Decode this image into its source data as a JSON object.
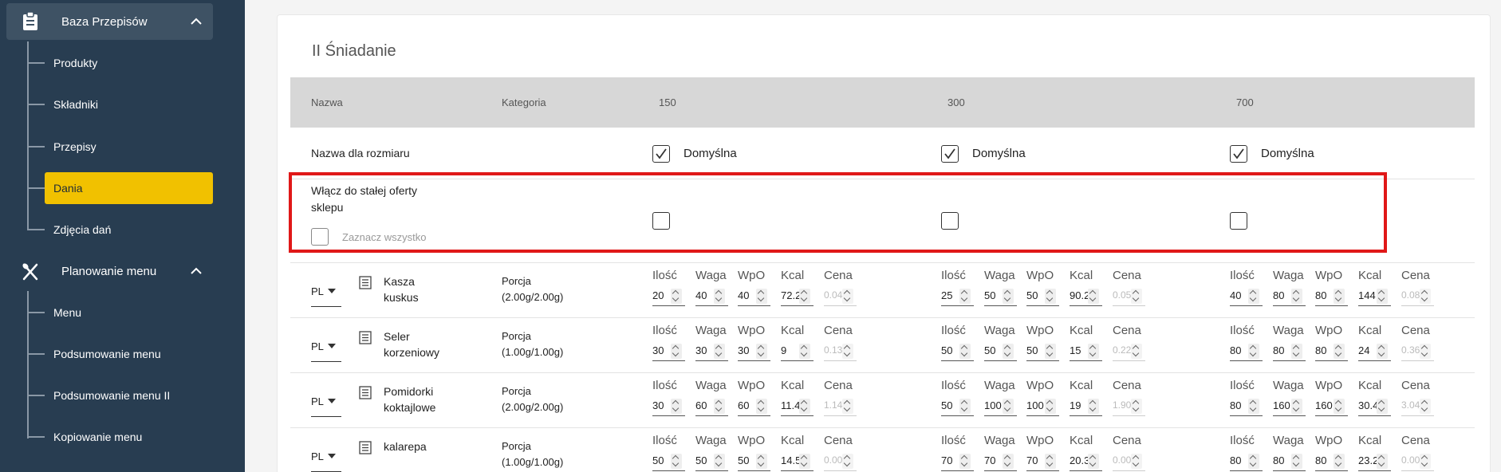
{
  "sidebar": {
    "section1": {
      "label": "Baza Przepisów",
      "icon": "clipboard-icon"
    },
    "items1": [
      {
        "label": "Produkty"
      },
      {
        "label": "Składniki"
      },
      {
        "label": "Przepisy"
      },
      {
        "label": "Dania",
        "selected": true
      },
      {
        "label": "Zdjęcia dań"
      }
    ],
    "section2": {
      "label": "Planowanie menu",
      "icon": "utensils-icon"
    },
    "items2": [
      {
        "label": "Menu"
      },
      {
        "label": "Podsumowanie menu"
      },
      {
        "label": "Podsumowanie menu II"
      },
      {
        "label": "Kopiowanie menu"
      }
    ]
  },
  "card": {
    "title": "II Śniadanie",
    "headers": {
      "name": "Nazwa",
      "category": "Kategoria",
      "size1": "150",
      "size2": "300",
      "size3": "700"
    },
    "size_name_row": {
      "label": "Nazwa dla rozmiaru",
      "default_label": "Domyślna"
    },
    "offer_row": {
      "label_line1": "Włącz do stałej oferty",
      "label_line2": "sklepu",
      "select_all": "Zaznacz wszystko"
    },
    "col_heads": [
      "Ilość",
      "Waga",
      "WpO",
      "Kcal",
      "Cena"
    ],
    "products": [
      {
        "lang": "PL",
        "name1": "Kasza",
        "name2": "kuskus",
        "cat1": "Porcja",
        "cat2": "(2.00g/2.00g)",
        "sizes": [
          [
            "20",
            "40",
            "40",
            "72.2",
            "0.04"
          ],
          [
            "25",
            "50",
            "50",
            "90.2",
            "0.05"
          ],
          [
            "40",
            "80",
            "80",
            "144",
            "0.08"
          ]
        ]
      },
      {
        "lang": "PL",
        "name1": "Seler",
        "name2": "korzeniowy",
        "cat1": "Porcja",
        "cat2": "(1.00g/1.00g)",
        "sizes": [
          [
            "30",
            "30",
            "30",
            "9",
            "0.13"
          ],
          [
            "50",
            "50",
            "50",
            "15",
            "0.22"
          ],
          [
            "80",
            "80",
            "80",
            "24",
            "0.36"
          ]
        ]
      },
      {
        "lang": "PL",
        "name1": "Pomidorki",
        "name2": "koktajlowe",
        "cat1": "Porcja",
        "cat2": "(2.00g/2.00g)",
        "sizes": [
          [
            "30",
            "60",
            "60",
            "11.4",
            "1.14"
          ],
          [
            "50",
            "100",
            "100",
            "19",
            "1.90"
          ],
          [
            "80",
            "160",
            "160",
            "30.4",
            "3.04"
          ]
        ]
      },
      {
        "lang": "PL",
        "name1": "kalarepa",
        "name2": "",
        "cat1": "Porcja",
        "cat2": "(1.00g/1.00g)",
        "sizes": [
          [
            "50",
            "50",
            "50",
            "14.5",
            "0.00"
          ],
          [
            "70",
            "70",
            "70",
            "20.3",
            "0.00"
          ],
          [
            "80",
            "80",
            "80",
            "23.2",
            "0.00"
          ]
        ]
      }
    ]
  }
}
